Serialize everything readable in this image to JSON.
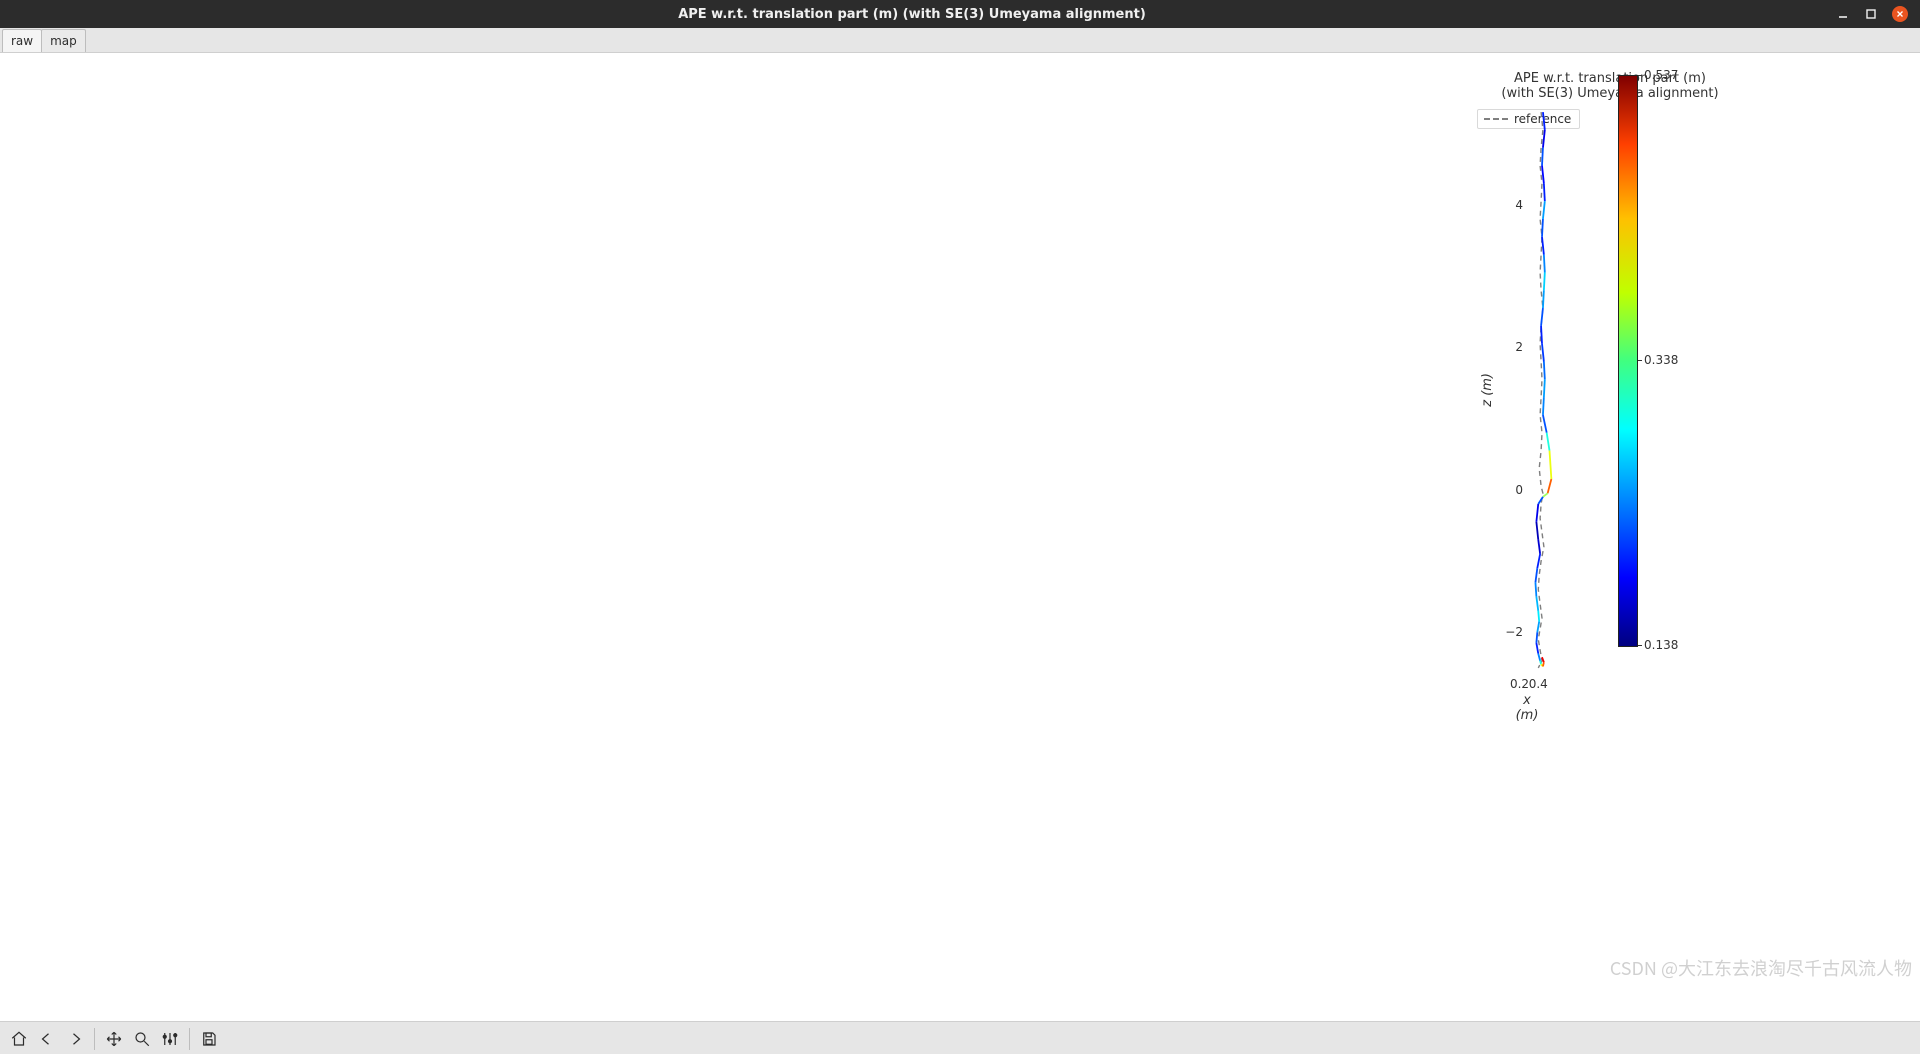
{
  "window": {
    "title": "APE w.r.t. translation part (m) (with SE(3) Umeyama alignment)"
  },
  "tabs": [
    {
      "label": "raw",
      "active": true
    },
    {
      "label": "map",
      "active": false
    }
  ],
  "toolbar": {
    "home": "Home",
    "back": "Back",
    "forward": "Forward",
    "pan": "Pan",
    "zoom": "Zoom",
    "configure": "Configure subplots",
    "save": "Save figure"
  },
  "watermark": "CSDN @大江东去浪淘尽千古风流人物",
  "chart_data": {
    "type": "line",
    "title_line1": "APE w.r.t. translation part (m)",
    "title_line2": "(with SE(3) Umeyama alignment)",
    "xlabel": "x (m)",
    "ylabel": "z (m)",
    "xlim": [
      0.12,
      0.44
    ],
    "ylim": [
      -2.6,
      5.4
    ],
    "xticks": [
      "0.2",
      "0.4"
    ],
    "yticks": [
      "−2",
      "0",
      "2",
      "4"
    ],
    "legend": {
      "label": "reference",
      "style": "dashed-gray"
    },
    "colorbar": {
      "cmap": "jet",
      "vmin": 0.138,
      "vmax": 0.537,
      "ticks": [
        "0.138",
        "0.338",
        "0.537"
      ]
    },
    "reference_trajectory": {
      "x": [
        0.27,
        0.29,
        0.27,
        0.26,
        0.28,
        0.27,
        0.26,
        0.28,
        0.27,
        0.26,
        0.27,
        0.29,
        0.27,
        0.26,
        0.27,
        0.28,
        0.27,
        0.26,
        0.28,
        0.27,
        0.25,
        0.27,
        0.29,
        0.27,
        0.26,
        0.28,
        0.3,
        0.27,
        0.25,
        0.24,
        0.26,
        0.28,
        0.26,
        0.24,
        0.26,
        0.28,
        0.26,
        0.24,
        0.26,
        0.28
      ],
      "z": [
        5.3,
        5.05,
        4.8,
        4.55,
        4.3,
        4.05,
        3.8,
        3.55,
        3.3,
        3.05,
        2.8,
        2.55,
        2.3,
        2.05,
        1.8,
        1.55,
        1.3,
        1.05,
        0.8,
        0.55,
        0.3,
        0.05,
        -0.05,
        -0.2,
        -0.4,
        -0.6,
        -0.8,
        -1.0,
        -1.2,
        -1.4,
        -1.6,
        -1.8,
        -1.95,
        -2.1,
        -2.25,
        -2.4,
        -2.45,
        -2.5,
        -2.45,
        -2.4
      ]
    },
    "estimated_trajectory": {
      "x": [
        0.29,
        0.31,
        0.29,
        0.28,
        0.3,
        0.31,
        0.29,
        0.28,
        0.3,
        0.31,
        0.3,
        0.29,
        0.27,
        0.28,
        0.3,
        0.31,
        0.3,
        0.29,
        0.33,
        0.36,
        0.38,
        0.34,
        0.29,
        0.24,
        0.22,
        0.24,
        0.26,
        0.23,
        0.21,
        0.22,
        0.24,
        0.25,
        0.23,
        0.22,
        0.24,
        0.26,
        0.27,
        0.29,
        0.3,
        0.28
      ],
      "z": [
        5.3,
        5.05,
        4.8,
        4.55,
        4.3,
        4.05,
        3.8,
        3.55,
        3.3,
        3.05,
        2.8,
        2.55,
        2.3,
        2.05,
        1.8,
        1.55,
        1.3,
        1.05,
        0.8,
        0.55,
        0.15,
        -0.05,
        -0.1,
        -0.2,
        -0.45,
        -0.7,
        -0.9,
        -1.1,
        -1.3,
        -1.5,
        -1.7,
        -1.85,
        -2.0,
        -2.15,
        -2.3,
        -2.4,
        -2.45,
        -2.48,
        -2.42,
        -2.35
      ],
      "ape": [
        0.2,
        0.18,
        0.22,
        0.19,
        0.2,
        0.25,
        0.22,
        0.2,
        0.24,
        0.27,
        0.25,
        0.22,
        0.2,
        0.21,
        0.23,
        0.25,
        0.24,
        0.22,
        0.3,
        0.38,
        0.45,
        0.35,
        0.22,
        0.18,
        0.16,
        0.17,
        0.2,
        0.22,
        0.24,
        0.26,
        0.28,
        0.25,
        0.22,
        0.2,
        0.24,
        0.3,
        0.38,
        0.45,
        0.5,
        0.44
      ]
    }
  }
}
